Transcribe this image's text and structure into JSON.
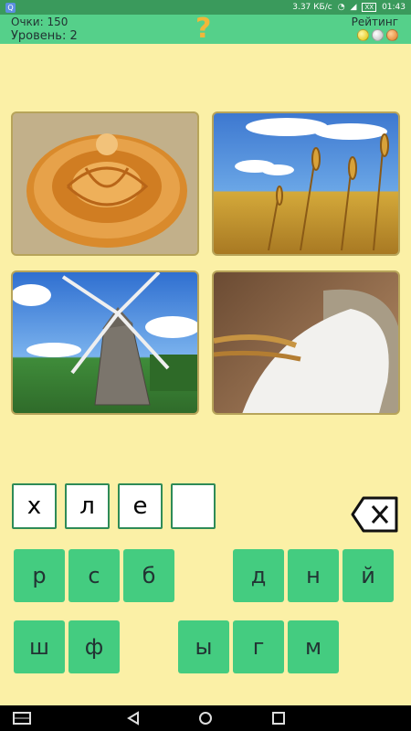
{
  "status_bar": {
    "speed": "3.37 КБ/с",
    "battery": "XX",
    "time": "01:43"
  },
  "header": {
    "score_label": "Очки: 150",
    "level_label": "Уровень: 2",
    "hint_symbol": "?",
    "rating_label": "Рейтинг"
  },
  "pictures": [
    "bread-loaf",
    "wheat-field",
    "windmill",
    "flour-sack"
  ],
  "answer": [
    "х",
    "л",
    "е",
    ""
  ],
  "keyboard": {
    "row1": [
      "р",
      "с",
      "б",
      "д",
      "н",
      "й"
    ],
    "row2": [
      "ш",
      "ф",
      "ы",
      "г",
      "м"
    ]
  }
}
